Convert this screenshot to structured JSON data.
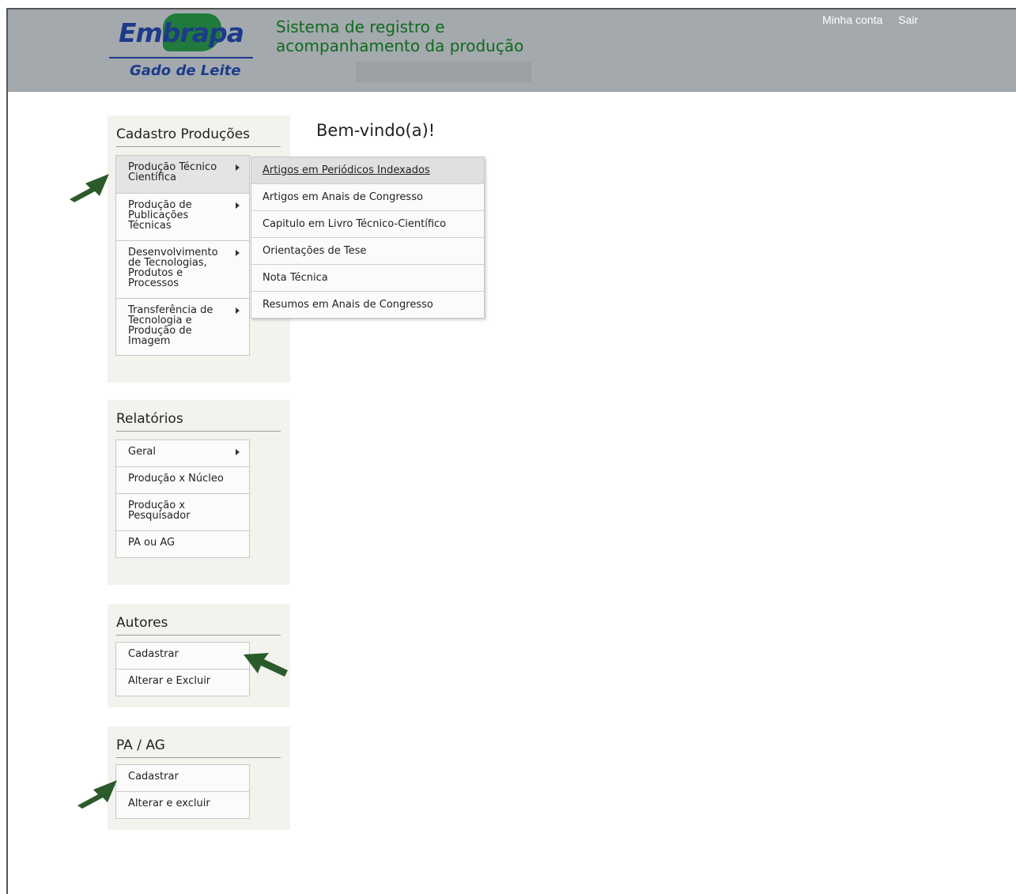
{
  "header": {
    "logo_text": "Embrapa",
    "logo_subtitle": "Gado de Leite",
    "app_title": "Sistema de registro e acompanhamento da produção",
    "links": [
      "Minha conta",
      "Sair"
    ]
  },
  "main": {
    "welcome": "Bem-vindo(a)!"
  },
  "cadastro": {
    "title": "Cadastro Produções",
    "items": [
      {
        "label": "Produção Técnico Científica"
      },
      {
        "label": "Produção de Publicações Técnicas"
      },
      {
        "label": "Desenvolvimento de Tecnologias, Produtos e Processos"
      },
      {
        "label": "Transferência de Tecnologia e Produção de Imagem"
      }
    ]
  },
  "submenu": {
    "items": [
      "Artigos em Periódicos Indexados",
      "Artigos em Anais de Congresso",
      "Capitulo em Livro Técnico-Científico",
      "Orientações de Tese",
      "Nota Técnica",
      "Resumos em Anais de Congresso"
    ]
  },
  "relatorios": {
    "title": "Relatórios",
    "items": [
      "Geral",
      "Produção x Núcleo",
      "Produção x Pesquisador",
      "PA ou AG"
    ]
  },
  "autores": {
    "title": "Autores",
    "items": [
      "Cadastrar",
      "Alterar e Excluir"
    ]
  },
  "pa_ag": {
    "title": "PA / AG",
    "items": [
      "Cadastrar",
      "Alterar e excluir"
    ]
  },
  "colors": {
    "header_bg": "#a4a9ae",
    "title_green": "#0e6b1c",
    "logo_blue": "#1e3a8a",
    "arrow_green": "#2b5a2b"
  },
  "icons": [
    "chevron-right-icon",
    "green-pointer-arrow-icon"
  ]
}
